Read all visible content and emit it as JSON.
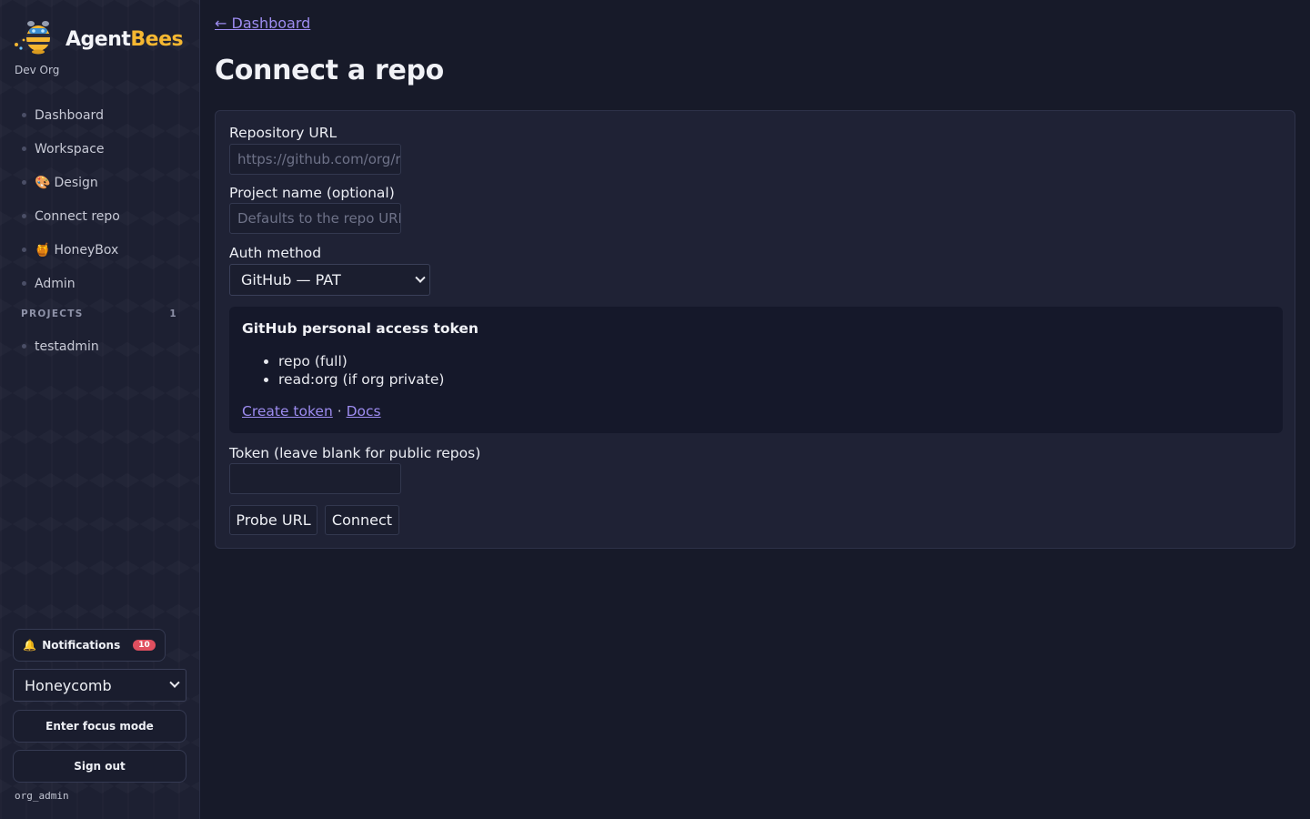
{
  "brand": {
    "name_part1": "Agent",
    "name_part2": "Bees",
    "org": "Dev Org"
  },
  "nav": [
    {
      "label": "Dashboard",
      "emoji": ""
    },
    {
      "label": "Workspace",
      "emoji": ""
    },
    {
      "label": "Design",
      "emoji": "🎨"
    },
    {
      "label": "Connect repo",
      "emoji": ""
    },
    {
      "label": "HoneyBox",
      "emoji": "🍯"
    },
    {
      "label": "Admin",
      "emoji": ""
    }
  ],
  "projects": {
    "heading": "PROJECTS",
    "count": "1",
    "items": [
      "testadmin"
    ]
  },
  "footer": {
    "notifications_label": "Notifications",
    "notifications_emoji": "🔔",
    "notifications_count": "10",
    "theme_value": "Honeycomb",
    "focus_label": "Enter focus mode",
    "signout_label": "Sign out",
    "user": "org_admin"
  },
  "main": {
    "back_label": "← Dashboard",
    "title": "Connect a repo",
    "repo_url_label": "Repository URL",
    "repo_url_placeholder": "https://github.com/org/repo",
    "project_name_label": "Project name (optional)",
    "project_name_placeholder": "Defaults to the repo URL",
    "auth_label": "Auth method",
    "auth_value": "GitHub — PAT",
    "info_title": "GitHub personal access token",
    "info_items": [
      "repo (full)",
      "read:org (if org private)"
    ],
    "create_token_link": "Create token",
    "link_separator": "·",
    "docs_link": "Docs",
    "token_label": "Token (leave blank for public repos)",
    "probe_label": "Probe URL",
    "connect_label": "Connect"
  },
  "colors": {
    "accent_link": "#9d8cf0",
    "brand_yellow": "#f5b731",
    "badge_red": "#e04f5f",
    "background": "#171a29"
  }
}
